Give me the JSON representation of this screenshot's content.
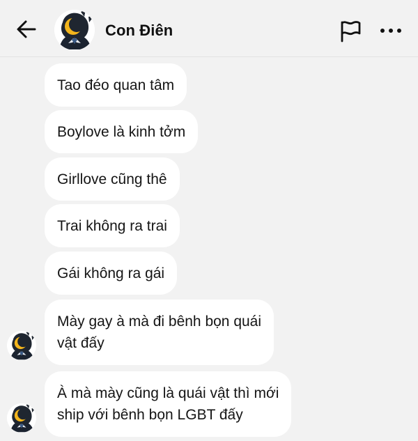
{
  "header": {
    "title": "Con Điên"
  },
  "messages": [
    {
      "text": "Tao đéo quan tâm"
    },
    {
      "text": "Boylove là kinh tởm"
    },
    {
      "text": "Girllove cũng thê"
    },
    {
      "text": "Trai không ra trai"
    },
    {
      "text": "Gái không ra gái"
    },
    {
      "line1": "Mày gay à mà đi bênh bọn quái",
      "line2": "vật đấy"
    },
    {
      "line1": "À mà mày cũng là quái vật thì mới",
      "line2": "ship với bênh bọn LGBT đấy"
    }
  ],
  "icons": {
    "back": "arrow-left-icon",
    "flag": "flag-icon",
    "more": "more-horizontal-icon",
    "avatar": "crescent-moon-creature-avatar"
  },
  "colors": {
    "background": "#f2f2f2",
    "bubble": "#ffffff",
    "text": "#151515",
    "avatar_dark": "#1f2630",
    "moon": "#f3b51c"
  }
}
